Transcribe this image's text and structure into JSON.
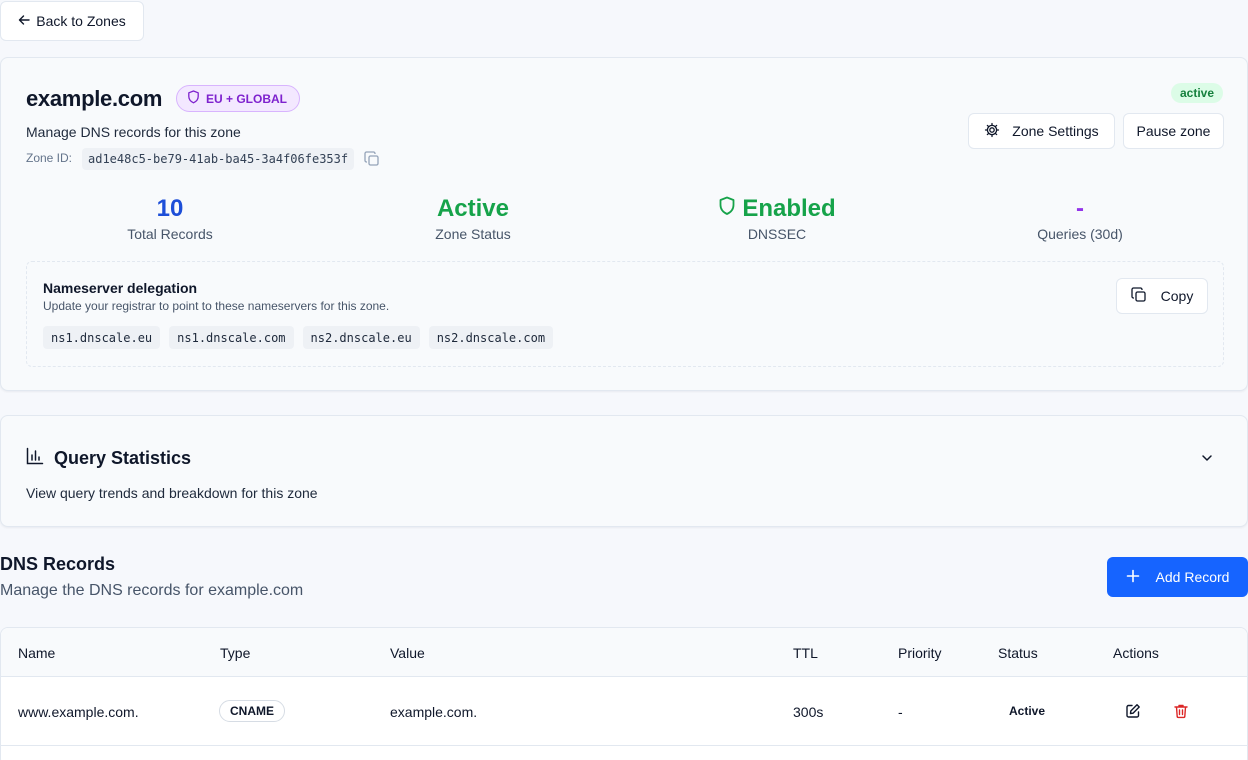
{
  "back_button": {
    "label": "Back to Zones",
    "icon": "arrow-left-icon"
  },
  "zone": {
    "name": "example.com",
    "region_badge": "EU + GLOBAL",
    "description": "Manage DNS records for this zone",
    "id_label": "Zone ID:",
    "id_value": "ad1e48c5-be79-41ab-ba45-3a4f06fe353f",
    "status": "active",
    "settings_label": "Zone Settings",
    "pause_label": "Pause zone"
  },
  "stats": [
    {
      "value": "10",
      "label": "Total Records",
      "color": "#1d4ed8"
    },
    {
      "value": "Active",
      "label": "Zone Status",
      "color": "#16a34a"
    },
    {
      "value": "Enabled",
      "label": "DNSSEC",
      "color": "#16a34a"
    },
    {
      "value": "-",
      "label": "Queries (30d)",
      "color": "#9333ea"
    }
  ],
  "nameservers": {
    "title": "Nameserver delegation",
    "subtitle": "Update your registrar to point to these nameservers for this zone.",
    "copy_label": "Copy",
    "list": [
      "ns1.dnscale.eu",
      "ns1.dnscale.com",
      "ns2.dnscale.eu",
      "ns2.dnscale.com"
    ]
  },
  "query_stats": {
    "title": "Query Statistics",
    "description": "View query trends and breakdown for this zone"
  },
  "dns_records": {
    "title": "DNS Records",
    "subtitle": "Manage the DNS records for example.com",
    "add_label": "Add Record",
    "columns": [
      "Name",
      "Type",
      "Value",
      "TTL",
      "Priority",
      "Status",
      "Actions"
    ],
    "rows": [
      {
        "name": "www.example.com.",
        "type": "CNAME",
        "value": "example.com.",
        "ttl": "300s",
        "priority": "-",
        "status": "Active"
      }
    ]
  },
  "colors": {
    "accent": "#1664ff",
    "danger": "#dc2626",
    "success": "#16a34a",
    "purple": "#7e22ce"
  }
}
